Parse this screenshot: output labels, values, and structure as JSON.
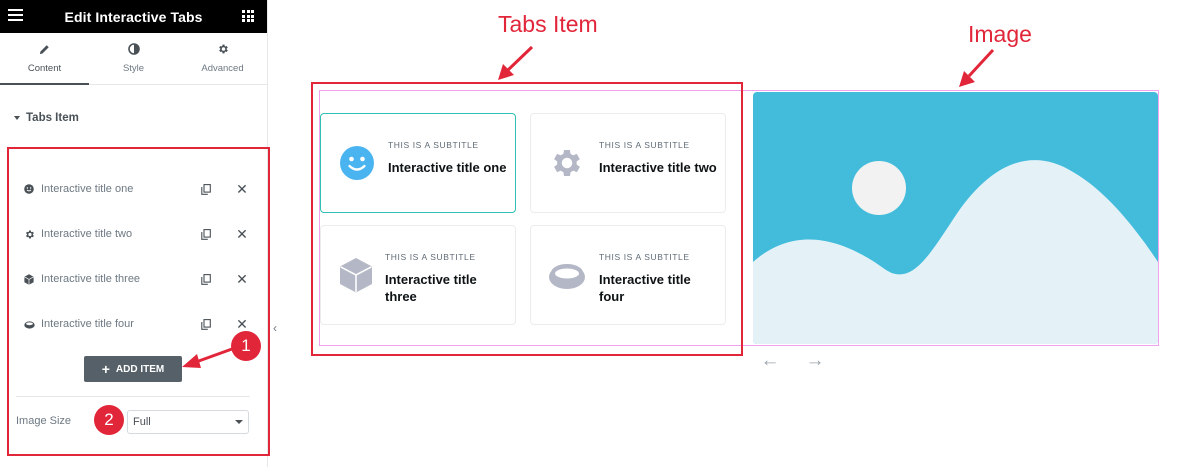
{
  "sidebar": {
    "title": "Edit Interactive Tabs",
    "tabs": [
      {
        "label": "Content",
        "icon": "pencil-icon"
      },
      {
        "label": "Style",
        "icon": "half-circle-icon"
      },
      {
        "label": "Advanced",
        "icon": "gear-icon"
      }
    ],
    "section_title": "Tabs Item",
    "items": [
      {
        "label": "Interactive title one",
        "icon": "smile-icon"
      },
      {
        "label": "Interactive title two",
        "icon": "gear-icon"
      },
      {
        "label": "Interactive title three",
        "icon": "cube-icon"
      },
      {
        "label": "Interactive title four",
        "icon": "ring-icon"
      }
    ],
    "add_item_label": "ADD ITEM",
    "image_size_label": "Image Size",
    "image_size_value": "Full"
  },
  "annotations": {
    "tabs_item": "Tabs Item",
    "image": "Image",
    "badge_1": "1",
    "badge_2": "2"
  },
  "preview": {
    "cards": [
      {
        "subtitle": "THIS IS A SUBTITLE",
        "title": "Interactive title one",
        "icon": "smile-icon",
        "active": true
      },
      {
        "subtitle": "THIS IS A SUBTITLE",
        "title": "Interactive title two",
        "icon": "gear-icon",
        "active": false
      },
      {
        "subtitle": "THIS IS A SUBTITLE",
        "title": "Interactive title three",
        "icon": "cube-icon",
        "active": false
      },
      {
        "subtitle": "THIS IS A SUBTITLE",
        "title": "Interactive title four",
        "icon": "ring-icon",
        "active": false
      }
    ],
    "image_icon": "placeholder-image-icon"
  },
  "colors": {
    "annotation_red": "#e2263a",
    "active_border": "#31c0b5",
    "icon_blue": "#4ab4f0",
    "icon_gray": "#b4b7c6",
    "sky": "#43bcdc",
    "hills": "#e4f2f8",
    "sun": "#f2f2f2"
  }
}
